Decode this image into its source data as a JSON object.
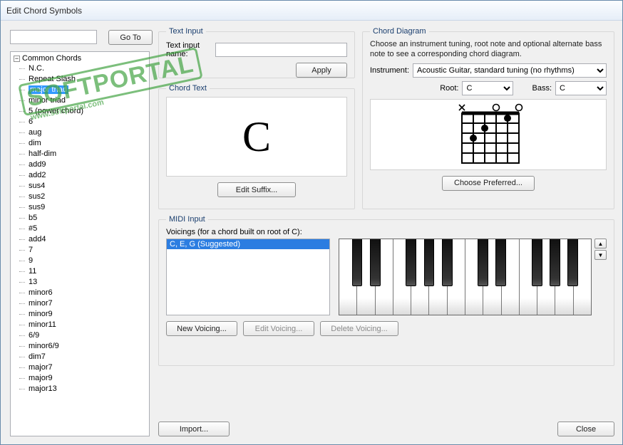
{
  "window": {
    "title": "Edit Chord Symbols"
  },
  "toolbar": {
    "goto_label": "Go To"
  },
  "tree": {
    "root": "Common Chords",
    "selected_index": 2,
    "items": [
      "N.C.",
      "Repeat Slash",
      "major triad",
      "minor triad",
      "5 (power chord)",
      "6",
      "aug",
      "dim",
      "half-dim",
      "add9",
      "add2",
      "sus4",
      "sus2",
      "sus9",
      "b5",
      "#5",
      "add4",
      "7",
      "9",
      "11",
      "13",
      "minor6",
      "minor7",
      "minor9",
      "minor11",
      "6/9",
      "minor6/9",
      "dim7",
      "major7",
      "major9",
      "major13"
    ]
  },
  "text_input": {
    "legend": "Text Input",
    "name_label": "Text input name:",
    "name_value": "",
    "apply_label": "Apply"
  },
  "chord_text": {
    "legend": "Chord Text",
    "display": "C",
    "edit_suffix_label": "Edit Suffix..."
  },
  "chord_diagram": {
    "legend": "Chord Diagram",
    "description": "Choose an instrument tuning, root note and optional alternate bass note to see a corresponding chord diagram.",
    "instrument_label": "Instrument:",
    "instrument_value": "Acoustic Guitar, standard tuning (no rhythms)",
    "root_label": "Root:",
    "root_value": "C",
    "bass_label": "Bass:",
    "bass_value": "C",
    "choose_preferred_label": "Choose Preferred..."
  },
  "midi": {
    "legend": "MIDI Input",
    "voicings_label": "Voicings (for a chord built on root of C):",
    "voicings": [
      "C, E, G (Suggested)"
    ],
    "new_voicing_label": "New Voicing...",
    "edit_voicing_label": "Edit Voicing...",
    "delete_voicing_label": "Delete Voicing..."
  },
  "footer": {
    "import_label": "Import...",
    "close_label": "Close"
  },
  "watermark": {
    "big": "SOFTPORTAL",
    "small": "www.softportal.com"
  }
}
